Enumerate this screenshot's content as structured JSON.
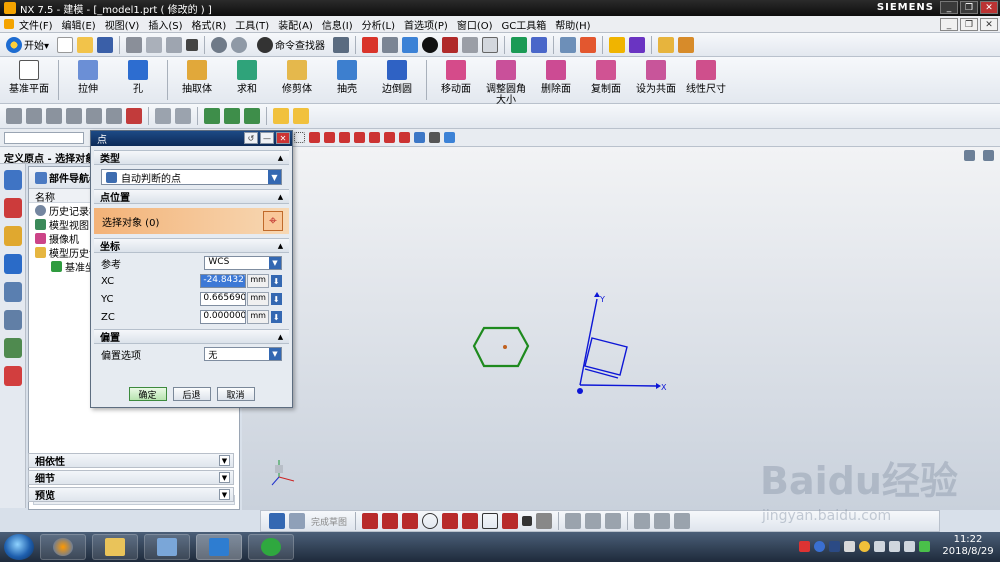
{
  "window": {
    "title": "NX 7.5 - 建模 - [_model1.prt  ( 修改的 ) ]",
    "brand": "SIEMENS",
    "controls": [
      "_",
      "❐",
      "✕"
    ]
  },
  "menubar": {
    "items": [
      "文件(F)",
      "编辑(E)",
      "视图(V)",
      "插入(S)",
      "格式(R)",
      "工具(T)",
      "装配(A)",
      "信息(I)",
      "分析(L)",
      "首选项(P)",
      "窗口(O)",
      "GC工具箱",
      "帮助(H)"
    ]
  },
  "toolbar1": {
    "start_label": "开始▾",
    "command_finder_label": "命令查找器"
  },
  "toolbar2": {
    "tools": [
      "基准平面",
      "拉伸",
      "孔",
      "抽取体",
      "求和",
      "修剪体",
      "抽壳",
      "边倒圆",
      "移动面",
      "调整圆角大小",
      "删除面",
      "复制面",
      "设为共面",
      "线性尺寸"
    ]
  },
  "cue_line": {
    "text": "定义原点 - 选择对象以自动判断点"
  },
  "navigator": {
    "title": "部件导航器",
    "column_header": "名称",
    "rows": [
      "历史记录模式",
      "模型视图",
      "摄像机",
      "模型历史记录",
      "基准坐标系"
    ],
    "panels": [
      "相依性",
      "细节",
      "预览"
    ]
  },
  "dialog": {
    "title": "点",
    "sections": {
      "type": "类型",
      "point_location": "点位置",
      "coordinates": "坐标",
      "offset": "偏置"
    },
    "type_value": "自动判断的点",
    "select_object_label": "选择对象 (0)",
    "reference_label": "参考",
    "reference_value": "WCS",
    "xc_label": "XC",
    "xc_value": "-24.84327",
    "yc_label": "YC",
    "yc_value": "0.665690",
    "zc_label": "ZC",
    "zc_value": "0.000000",
    "unit": "mm",
    "offset_option_label": "偏置选项",
    "offset_option_value": "无",
    "buttons": {
      "ok": "确定",
      "back": "后退",
      "cancel": "取消"
    }
  },
  "sketchbar": {
    "finish_label": "完成草图"
  },
  "taskbar": {
    "time": "11:22",
    "date": "2018/8/29"
  },
  "watermark": {
    "main": "Baidu经验",
    "sub": "jingyan.baidu.com"
  },
  "colors": {
    "hexagon": "#1e8a1e",
    "wcs": "#0d16d6",
    "dialog_title": "#0d2b57",
    "select_highlight": "#f3b277"
  }
}
